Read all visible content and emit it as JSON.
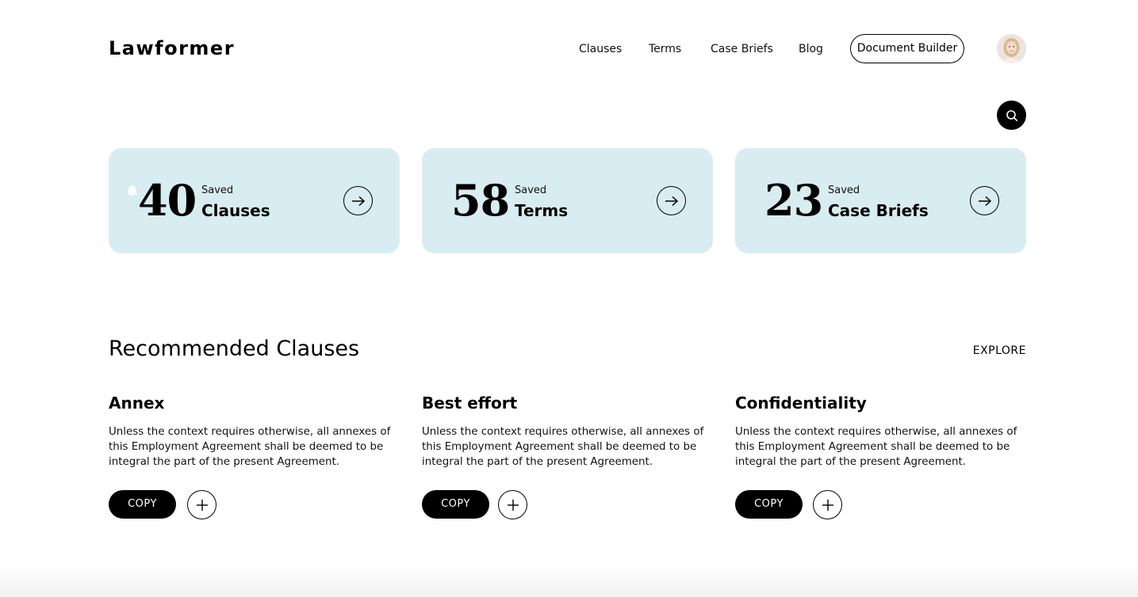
{
  "header": {
    "logo": "Lawformer",
    "nav": [
      "Clauses",
      "Terms",
      "Case Briefs",
      "Blog"
    ],
    "cta": "Document Builder",
    "avatar_icon": "user-avatar",
    "search_icon": "search-icon"
  },
  "stats": [
    {
      "count": "40",
      "sub": "Saved",
      "name": "Clauses",
      "has_notification": true
    },
    {
      "count": "58",
      "sub": "Saved",
      "name": "Terms"
    },
    {
      "count": "23",
      "sub": "Saved",
      "name": "Case Briefs"
    }
  ],
  "recommended": {
    "title": "Recommended Clauses",
    "explore": "EXPLORE",
    "clauses": [
      {
        "title": "Annex",
        "body": "Unless the context requires otherwise, all annexes of this Employment Agreement shall be deemed to be integral the part of the present Agreement.",
        "copy": "COPY"
      },
      {
        "title": "Best effort",
        "body": "Unless the context requires otherwise, all annexes of this Employment Agreement shall be deemed to be integral the part of the present Agreement.",
        "copy": "COPY"
      },
      {
        "title": "Confidentiality",
        "body": "Unless the context requires otherwise, all annexes of this Employment Agreement shall be deemed to be integral the part of the present Agreement.",
        "copy": "COPY"
      }
    ]
  },
  "colors": {
    "card_bg": "#d8edf2",
    "primary": "#000000",
    "background": "#ffffff"
  }
}
